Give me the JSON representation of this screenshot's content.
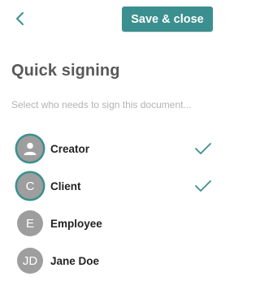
{
  "header": {
    "back_icon": "chevron-left-icon",
    "save_label": "Save & close"
  },
  "main": {
    "title": "Quick signing",
    "subtitle": "Select who needs to sign this document..."
  },
  "signers": [
    {
      "name": "Creator",
      "initials": "",
      "avatar_icon": "person-icon",
      "selected": true
    },
    {
      "name": "Client",
      "initials": "C",
      "selected": true
    },
    {
      "name": "Employee",
      "initials": "E",
      "selected": false
    },
    {
      "name": "Jane Doe",
      "initials": "JD",
      "selected": false
    }
  ],
  "colors": {
    "accent": "#3b8f8f",
    "avatar": "#9e9e9e",
    "title": "#595959",
    "placeholder": "#b3b3b3"
  }
}
